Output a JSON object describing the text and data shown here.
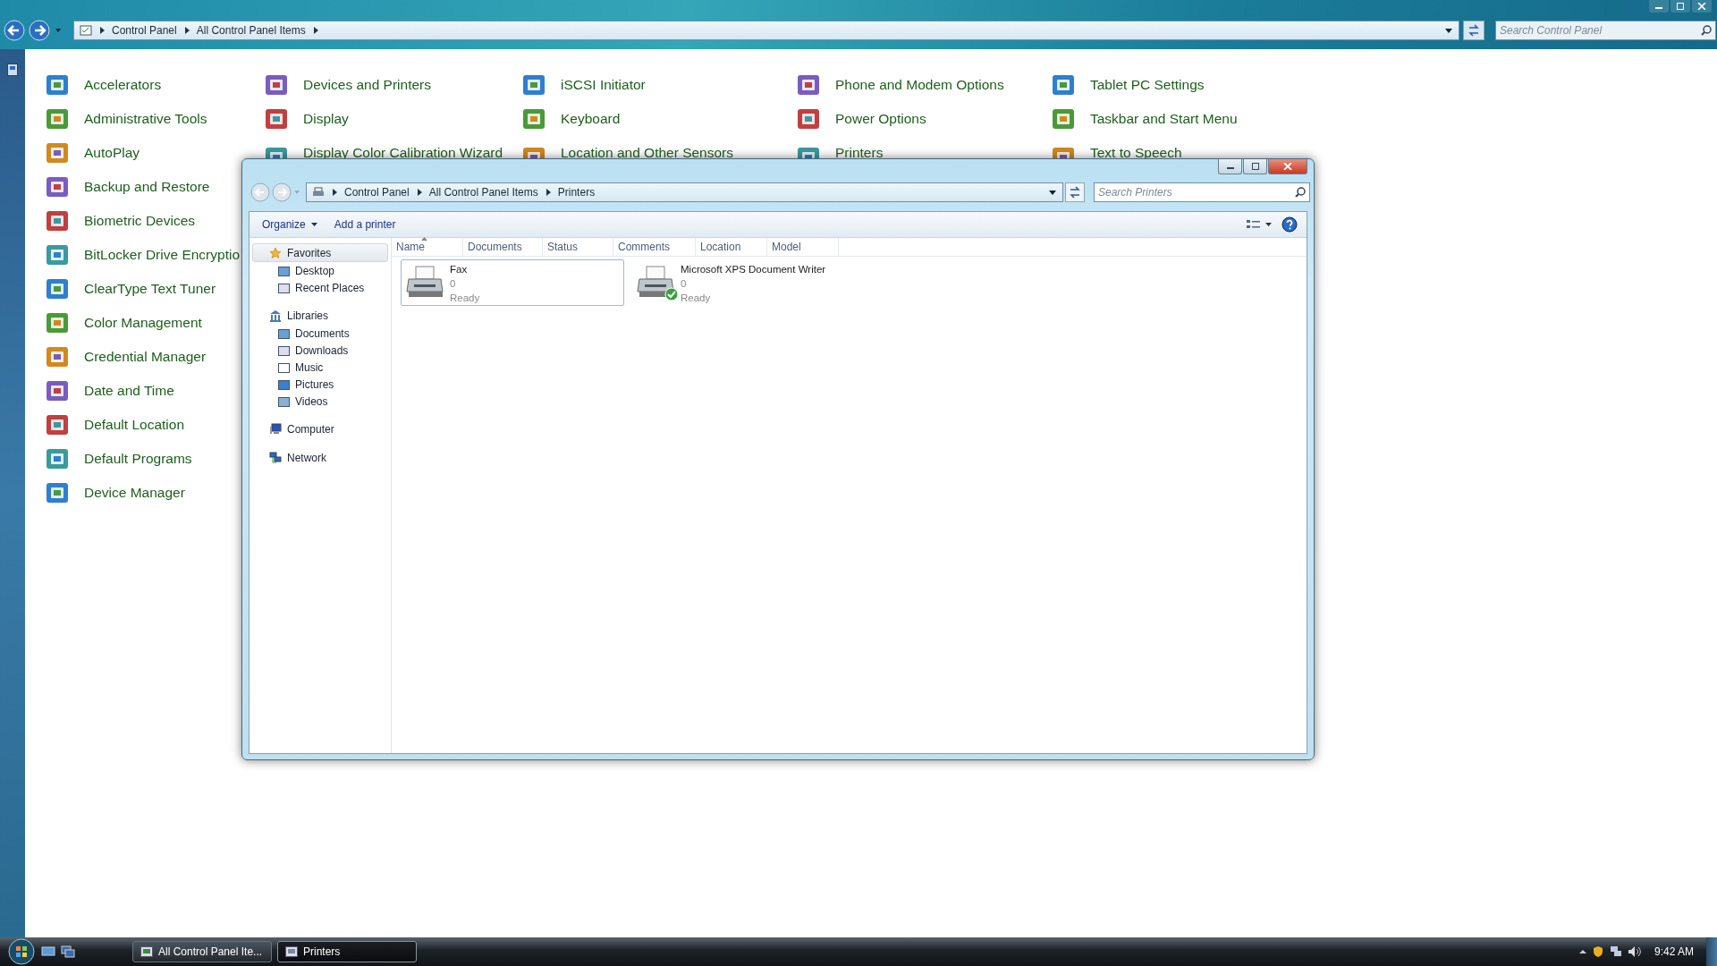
{
  "top_bar": {
    "breadcrumb": [
      "Control Panel",
      "All Control Panel Items"
    ],
    "search": {
      "placeholder": "Search Control Panel"
    }
  },
  "control_panel_columns": [
    [
      "Accelerators",
      "Administrative Tools",
      "AutoPlay",
      "Backup and Restore",
      "Biometric Devices",
      "BitLocker Drive Encryptio",
      "ClearType Text Tuner",
      "Color Management",
      "Credential Manager",
      "Date and Time",
      "Default Location",
      "Default Programs",
      "Device Manager"
    ],
    [
      "Devices and Printers",
      "Display",
      "Display Color Calibration Wizard"
    ],
    [
      "iSCSI Initiator",
      "Keyboard",
      "Location and Other Sensors"
    ],
    [
      "Phone and Modem Options",
      "Power Options",
      "Printers"
    ],
    [
      "Tablet PC Settings",
      "Taskbar and Start Menu",
      "Text to Speech"
    ]
  ],
  "window": {
    "breadcrumb": [
      "Control Panel",
      "All Control Panel Items",
      "Printers"
    ],
    "search": {
      "placeholder": "Search Printers"
    },
    "toolbar": [
      {
        "label": "Organize",
        "dropdown": true
      },
      {
        "label": "Add a printer",
        "dropdown": false
      }
    ],
    "sidebar": [
      {
        "label": "Favorites",
        "selected": true,
        "children": [
          {
            "label": "Desktop"
          },
          {
            "label": "Recent Places"
          }
        ]
      },
      {
        "label": "Libraries",
        "selected": false,
        "children": [
          {
            "label": "Documents"
          },
          {
            "label": "Downloads"
          },
          {
            "label": "Music"
          },
          {
            "label": "Pictures"
          },
          {
            "label": "Videos"
          }
        ]
      },
      {
        "label": "Computer",
        "selected": false
      },
      {
        "label": "Network",
        "selected": false
      }
    ],
    "columns": [
      {
        "label": "Name",
        "sorted": true
      },
      {
        "label": "Documents",
        "sorted": false
      },
      {
        "label": "Status",
        "sorted": false
      },
      {
        "label": "Comments",
        "sorted": false
      },
      {
        "label": "Location",
        "sorted": false
      },
      {
        "label": "Model",
        "sorted": false
      }
    ],
    "printers": [
      {
        "name": "Fax",
        "documents": "0",
        "status": "Ready",
        "selected": true,
        "default": false
      },
      {
        "name": "Microsoft XPS Document Writer",
        "documents": "0",
        "status": "Ready",
        "selected": false,
        "default": true
      }
    ]
  },
  "taskbar": {
    "tasks": [
      {
        "label": "All Control Panel Ite...",
        "selected": false
      },
      {
        "label": "Printers",
        "selected": true
      }
    ],
    "clock": "9:42 AM"
  }
}
